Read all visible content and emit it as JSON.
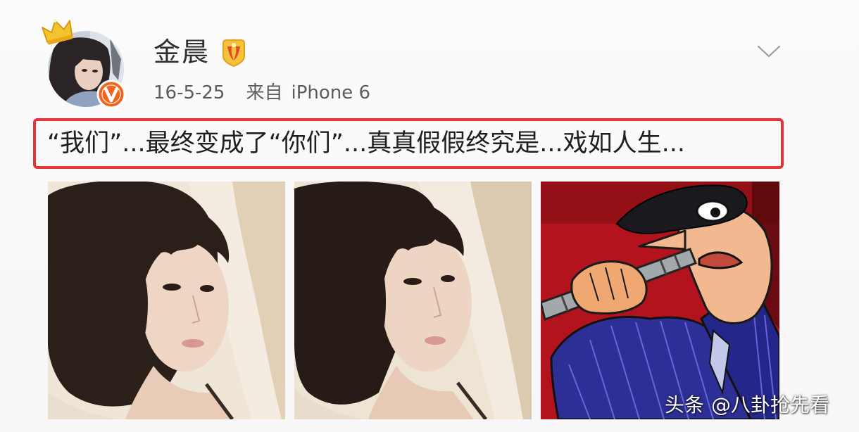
{
  "post": {
    "author": {
      "name": "金晨"
    },
    "meta": {
      "date": "16-5-25",
      "source_prefix": "来自",
      "source": "iPhone 6"
    },
    "text": "“我们”...最终变成了“你们”...真真假假终究是...戏如人生..."
  },
  "watermark": {
    "brand": "头条",
    "handle": "@八卦抢先看"
  },
  "icons": {
    "crown": "crown-icon",
    "verified": "verified-v-icon",
    "member": "member-badge-icon",
    "menu": "chevron-down-icon"
  },
  "colors": {
    "highlight_border": "#e5343a",
    "verified_badge": "#f0641d",
    "member_badge": "#f5c23a",
    "name_text": "#2f2f2f",
    "meta_text": "#5c5c5c"
  }
}
